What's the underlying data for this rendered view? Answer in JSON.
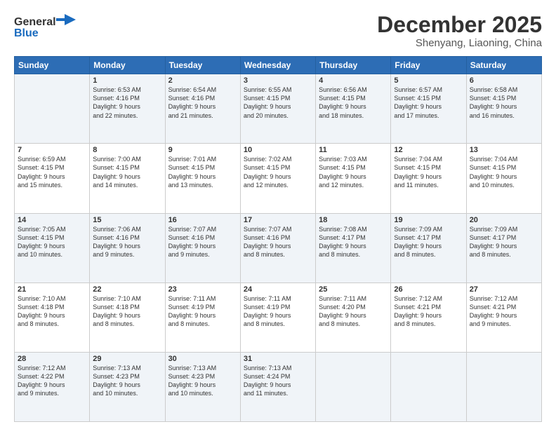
{
  "header": {
    "logo_line1": "General",
    "logo_line2": "Blue",
    "month": "December 2025",
    "location": "Shenyang, Liaoning, China"
  },
  "weekdays": [
    "Sunday",
    "Monday",
    "Tuesday",
    "Wednesday",
    "Thursday",
    "Friday",
    "Saturday"
  ],
  "weeks": [
    [
      {
        "day": "",
        "info": ""
      },
      {
        "day": "1",
        "info": "Sunrise: 6:53 AM\nSunset: 4:16 PM\nDaylight: 9 hours\nand 22 minutes."
      },
      {
        "day": "2",
        "info": "Sunrise: 6:54 AM\nSunset: 4:16 PM\nDaylight: 9 hours\nand 21 minutes."
      },
      {
        "day": "3",
        "info": "Sunrise: 6:55 AM\nSunset: 4:15 PM\nDaylight: 9 hours\nand 20 minutes."
      },
      {
        "day": "4",
        "info": "Sunrise: 6:56 AM\nSunset: 4:15 PM\nDaylight: 9 hours\nand 18 minutes."
      },
      {
        "day": "5",
        "info": "Sunrise: 6:57 AM\nSunset: 4:15 PM\nDaylight: 9 hours\nand 17 minutes."
      },
      {
        "day": "6",
        "info": "Sunrise: 6:58 AM\nSunset: 4:15 PM\nDaylight: 9 hours\nand 16 minutes."
      }
    ],
    [
      {
        "day": "7",
        "info": "Sunrise: 6:59 AM\nSunset: 4:15 PM\nDaylight: 9 hours\nand 15 minutes."
      },
      {
        "day": "8",
        "info": "Sunrise: 7:00 AM\nSunset: 4:15 PM\nDaylight: 9 hours\nand 14 minutes."
      },
      {
        "day": "9",
        "info": "Sunrise: 7:01 AM\nSunset: 4:15 PM\nDaylight: 9 hours\nand 13 minutes."
      },
      {
        "day": "10",
        "info": "Sunrise: 7:02 AM\nSunset: 4:15 PM\nDaylight: 9 hours\nand 12 minutes."
      },
      {
        "day": "11",
        "info": "Sunrise: 7:03 AM\nSunset: 4:15 PM\nDaylight: 9 hours\nand 12 minutes."
      },
      {
        "day": "12",
        "info": "Sunrise: 7:04 AM\nSunset: 4:15 PM\nDaylight: 9 hours\nand 11 minutes."
      },
      {
        "day": "13",
        "info": "Sunrise: 7:04 AM\nSunset: 4:15 PM\nDaylight: 9 hours\nand 10 minutes."
      }
    ],
    [
      {
        "day": "14",
        "info": "Sunrise: 7:05 AM\nSunset: 4:15 PM\nDaylight: 9 hours\nand 10 minutes."
      },
      {
        "day": "15",
        "info": "Sunrise: 7:06 AM\nSunset: 4:16 PM\nDaylight: 9 hours\nand 9 minutes."
      },
      {
        "day": "16",
        "info": "Sunrise: 7:07 AM\nSunset: 4:16 PM\nDaylight: 9 hours\nand 9 minutes."
      },
      {
        "day": "17",
        "info": "Sunrise: 7:07 AM\nSunset: 4:16 PM\nDaylight: 9 hours\nand 8 minutes."
      },
      {
        "day": "18",
        "info": "Sunrise: 7:08 AM\nSunset: 4:17 PM\nDaylight: 9 hours\nand 8 minutes."
      },
      {
        "day": "19",
        "info": "Sunrise: 7:09 AM\nSunset: 4:17 PM\nDaylight: 9 hours\nand 8 minutes."
      },
      {
        "day": "20",
        "info": "Sunrise: 7:09 AM\nSunset: 4:17 PM\nDaylight: 9 hours\nand 8 minutes."
      }
    ],
    [
      {
        "day": "21",
        "info": "Sunrise: 7:10 AM\nSunset: 4:18 PM\nDaylight: 9 hours\nand 8 minutes."
      },
      {
        "day": "22",
        "info": "Sunrise: 7:10 AM\nSunset: 4:18 PM\nDaylight: 9 hours\nand 8 minutes."
      },
      {
        "day": "23",
        "info": "Sunrise: 7:11 AM\nSunset: 4:19 PM\nDaylight: 9 hours\nand 8 minutes."
      },
      {
        "day": "24",
        "info": "Sunrise: 7:11 AM\nSunset: 4:19 PM\nDaylight: 9 hours\nand 8 minutes."
      },
      {
        "day": "25",
        "info": "Sunrise: 7:11 AM\nSunset: 4:20 PM\nDaylight: 9 hours\nand 8 minutes."
      },
      {
        "day": "26",
        "info": "Sunrise: 7:12 AM\nSunset: 4:21 PM\nDaylight: 9 hours\nand 8 minutes."
      },
      {
        "day": "27",
        "info": "Sunrise: 7:12 AM\nSunset: 4:21 PM\nDaylight: 9 hours\nand 9 minutes."
      }
    ],
    [
      {
        "day": "28",
        "info": "Sunrise: 7:12 AM\nSunset: 4:22 PM\nDaylight: 9 hours\nand 9 minutes."
      },
      {
        "day": "29",
        "info": "Sunrise: 7:13 AM\nSunset: 4:23 PM\nDaylight: 9 hours\nand 10 minutes."
      },
      {
        "day": "30",
        "info": "Sunrise: 7:13 AM\nSunset: 4:23 PM\nDaylight: 9 hours\nand 10 minutes."
      },
      {
        "day": "31",
        "info": "Sunrise: 7:13 AM\nSunset: 4:24 PM\nDaylight: 9 hours\nand 11 minutes."
      },
      {
        "day": "",
        "info": ""
      },
      {
        "day": "",
        "info": ""
      },
      {
        "day": "",
        "info": ""
      }
    ]
  ]
}
